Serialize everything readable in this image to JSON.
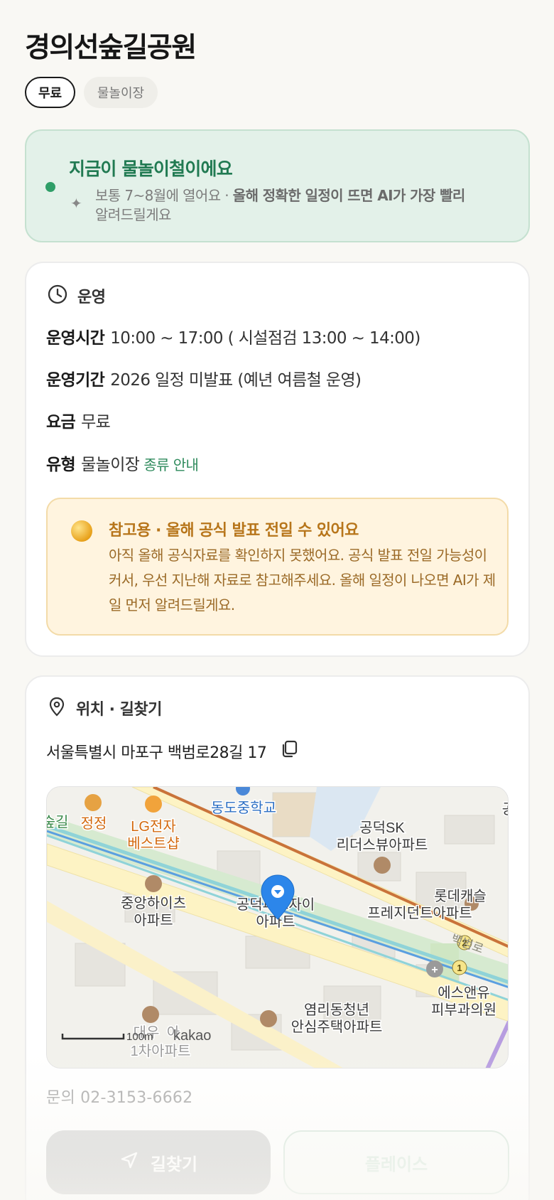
{
  "header": {
    "title": "경의선숲길공원"
  },
  "chips": [
    {
      "label": "무료",
      "active": true
    },
    {
      "label": "물놀이장",
      "active": false
    }
  ],
  "season_banner": {
    "headline": "지금이 물놀이철이에요",
    "note_plain": "보통 7~8월에 열어요 · ",
    "note_bold": "올해 정확한 일정이 뜨면 AI가 가장 빨리",
    "note_tail": "알려드릴게요",
    "icon": "sparkle-icon",
    "dot_color": "#2f9e68"
  },
  "operation": {
    "heading": "운영",
    "icon": "clock-icon",
    "rows": [
      {
        "key": "운영시간",
        "value": "10:00 ~ 17:00 ( 시설점검 13:00 ~ 14:00)"
      },
      {
        "key": "운영기간",
        "value": "2026 일정 미발표 (예년 여름철 운영)"
      },
      {
        "key": "요금",
        "value": "무료"
      },
      {
        "key": "유형",
        "value": "물놀이장",
        "link": "종류 안내"
      }
    ],
    "notice": {
      "title": "참고용 · 올해 공식 발표 전일 수 있어요",
      "body": "아직 올해 공식자료를 확인하지 못했어요. 공식 발표 전일 가능성이 커서, 우선 지난해 자료로 참고해주세요. 올해 일정이 나오면 AI가 제일 먼저 알려드릴게요."
    }
  },
  "location": {
    "heading": "위치 · 길찾기",
    "icon": "location-pin-icon",
    "address": "서울특별시 마포구 백범로28길 17",
    "copy_icon": "copy-icon",
    "map": {
      "labels": {
        "school": "동도중학교",
        "forest_road": "숲길",
        "jeongjeong": "정정",
        "lg_line1": "LG전자",
        "lg_line2": "베스트샵",
        "sk_line1": "공덕SK",
        "sk_line2": "리더스뷰아파트",
        "jungang_line1": "중앙하이츠",
        "jungang_line2": "아파트",
        "park_line1": "공덕파크자이",
        "park_line2": "아파트",
        "lotte_line1": "롯데캐슬",
        "lotte_line2": "프레지던트아파트",
        "baekbeom": "백범로",
        "sn_line1": "에스앤유",
        "sn_line2": "피부과의원",
        "yeomni_line1": "염리동청년",
        "yeomni_line2": "안심주택아파트",
        "scale": "100m",
        "brand": "kakao",
        "partial_left": "대우",
        "partial_right": "아",
        "partial_bottom": "1차아파트",
        "partial_top_right": "공",
        "badge_1": "1",
        "badge_2": "2"
      },
      "colors": {
        "road_major": "#fdf3c4",
        "subway_orange": "#c9733a",
        "subway_blue": "#5a9fe0",
        "subway_teal": "#8fd3d8",
        "green": "#cfe6c3",
        "pin": "#2c86ea"
      }
    },
    "contact": "문의 02-3153-6662",
    "buttons": {
      "directions": "길찾기",
      "place": "플레이스"
    }
  }
}
